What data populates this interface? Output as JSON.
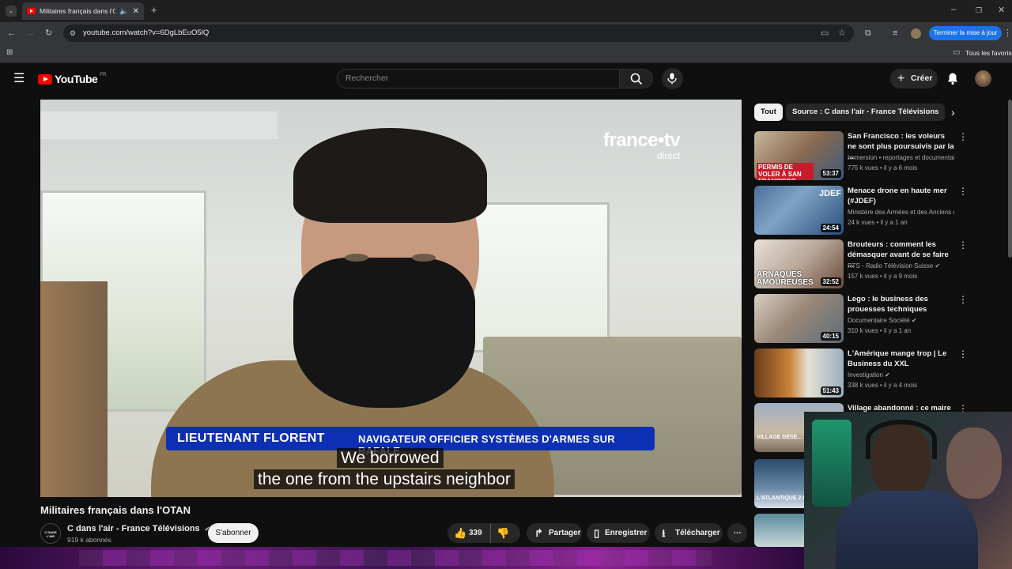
{
  "browser": {
    "tab_title": "Militaires français dans l'OTA",
    "url": "youtube.com/watch?v=6DgLbEuO5lQ",
    "update_button": "Terminer la mise à jour",
    "bookmarks_all": "Tous les favoris"
  },
  "youtube": {
    "logo_text": "YouTube",
    "logo_region": "FR",
    "search_placeholder": "Rechercher",
    "create_label": "Créer"
  },
  "video": {
    "watermark_brand": "france•tv",
    "watermark_sub": "direct",
    "lower_third_name": "LIEUTENANT FLORENT",
    "lower_third_role": "NAVIGATEUR OFFICIER SYSTÈMES D'ARMES SUR RAFALE",
    "subtitle_line1": "We borrowed",
    "subtitle_line2": "the one from the upstairs neighbor",
    "title": "Militaires français dans l'OTAN",
    "channel_name": "C dans l'air - France Télévisions",
    "channel_subscribers": "919 k abonnés",
    "channel_avatar_text": "C DANS L'AIR",
    "subscribe_label": "S'abonner",
    "likes": "339",
    "share_label": "Partager",
    "save_label": "Enregistrer",
    "download_label": "Télécharger"
  },
  "sidebar": {
    "chips": [
      "Tout",
      "Source : C dans l'air - France Télévisions"
    ],
    "recommendations": [
      {
        "title": "San Francisco : les voleurs ne sont plus poursuivis par la ...",
        "channel": "Immersion • reportages et documentair...",
        "meta": "775 k vues • il y a 6 mois",
        "duration": "53:37",
        "thumb_text": "PERMIS DE VOLER À SAN FRANCISCO"
      },
      {
        "title": "Menace drone en haute mer (#JDEF)",
        "channel": "Ministère des Armées et des Anciens co...",
        "meta": "24 k vues • il y a 1 an",
        "duration": "24:54",
        "thumb_text": "JDEF"
      },
      {
        "title": "Brouteurs : comment les démasquer avant de se faire ...",
        "channel": "RTS - Radio Télévision Suisse",
        "meta": "157 k vues • il y a 9 mois",
        "duration": "32:52",
        "thumb_text": "ARNAQUES AMOUREUSES"
      },
      {
        "title": "Lego : le business des prouesses techniques",
        "channel": "Documentaire Société",
        "meta": "310 k vues • il y a 1 an",
        "duration": "40:15",
        "thumb_text": ""
      },
      {
        "title": "L'Amérique mange trop | Le Business du XXL",
        "channel": "Investigation",
        "meta": "338 k vues • il y a 4 mois",
        "duration": "51:43",
        "thumb_text": ""
      },
      {
        "title": "Village abandonné : ce maire se",
        "channel": "",
        "meta": "",
        "duration": "",
        "thumb_text": "VILLAGE DÉSE..."
      },
      {
        "title": "",
        "channel": "",
        "meta": "",
        "duration": "",
        "thumb_text": "L'ATLANTIQUE 2 F..."
      },
      {
        "title": "",
        "channel": "",
        "meta": "",
        "duration": "",
        "thumb_text": ""
      }
    ]
  },
  "colors": {
    "yt_red": "#ff0000",
    "lower_third_blue": "#0d2fb4",
    "accent_blue": "#1a73e8"
  }
}
